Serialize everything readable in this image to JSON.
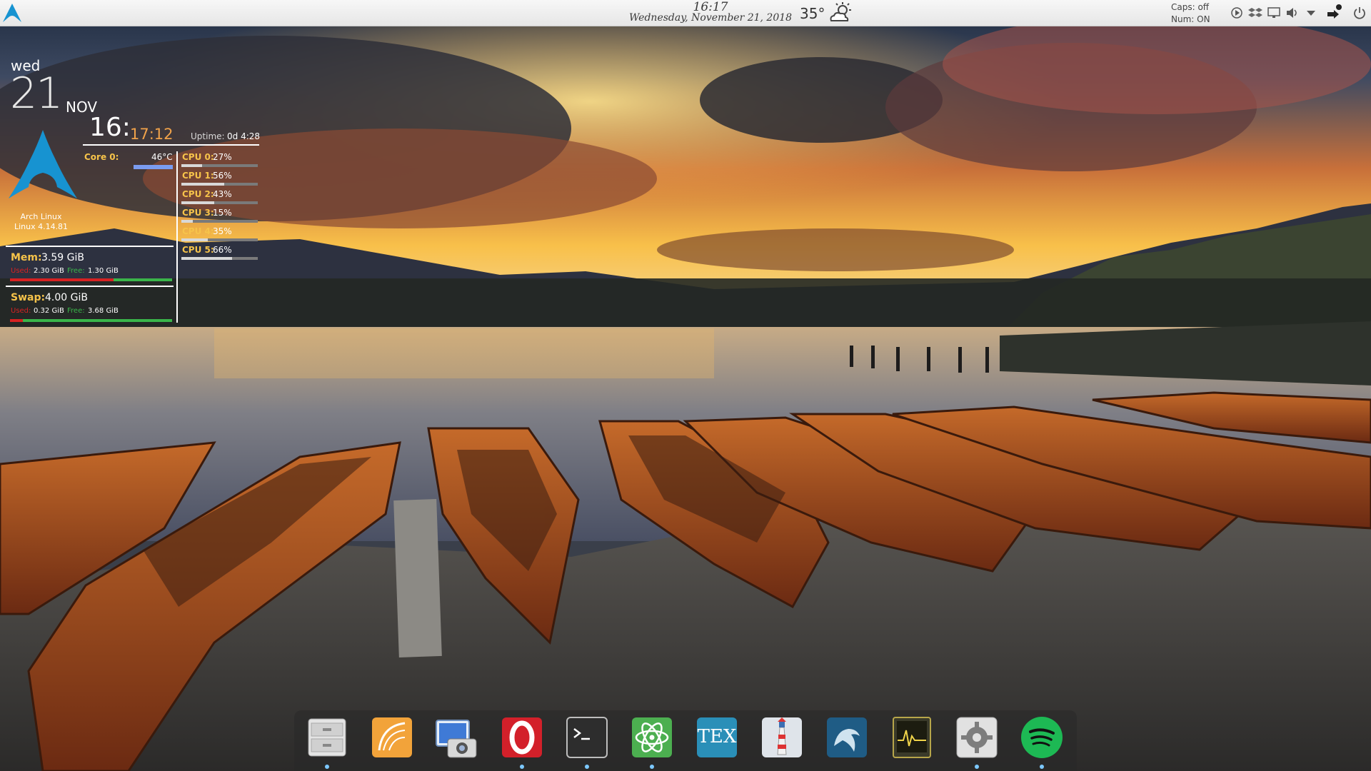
{
  "panel": {
    "time": "16:17",
    "date": "Wednesday, November 21, 2018",
    "weather_temp": "35°",
    "weather_icon": "partly-sunny-icon",
    "caps": "Caps: off",
    "num": "Num: ON",
    "tray_icons": [
      "media-play-icon",
      "dropbox-icon",
      "display-icon",
      "volume-icon",
      "chevron-down-icon",
      "network-icon",
      "power-icon"
    ]
  },
  "conky": {
    "day": "wed",
    "date": "21",
    "month": "NOV",
    "hour_min": "16:",
    "seconds": "17:12",
    "uptime_label": "Uptime:",
    "uptime_value": "0d 4:28",
    "distro": "Arch Linux",
    "kernel": "Linux 4.14.81",
    "core_label": "Core 0:",
    "core_temp": "46°C",
    "cpus": [
      {
        "label": "CPU 0:",
        "value": "27%",
        "pct": 27
      },
      {
        "label": "CPU 1:",
        "value": "56%",
        "pct": 56
      },
      {
        "label": "CPU 2:",
        "value": "43%",
        "pct": 43
      },
      {
        "label": "CPU 3:",
        "value": "15%",
        "pct": 15
      },
      {
        "label": "CPU 4:",
        "value": "35%",
        "pct": 35
      },
      {
        "label": "CPU 5:",
        "value": "66%",
        "pct": 66
      }
    ],
    "mem_label": "Mem:",
    "mem_total": "3.59 GiB",
    "mem_used_label": "Used:",
    "mem_used": "2.30 GiB",
    "mem_free_label": "Free:",
    "mem_free": "1.30 GiB",
    "mem_used_frac": 0.64,
    "swap_label": "Swap:",
    "swap_total": "4.00 GiB",
    "swap_used_label": "Used:",
    "swap_used": "0.32 GiB",
    "swap_free_label": "Free:",
    "swap_free": "3.68 GiB",
    "swap_used_frac": 0.08
  },
  "dock": {
    "items": [
      {
        "name": "file-manager-icon",
        "active": true
      },
      {
        "name": "sublime-text-icon",
        "active": false
      },
      {
        "name": "screenshot-icon",
        "active": false
      },
      {
        "name": "opera-icon",
        "active": true
      },
      {
        "name": "terminal-icon",
        "active": true
      },
      {
        "name": "atom-icon",
        "active": true
      },
      {
        "name": "tex-icon",
        "active": false
      },
      {
        "name": "lighthouse-icon",
        "active": false
      },
      {
        "name": "mysql-workbench-icon",
        "active": false
      },
      {
        "name": "system-monitor-icon",
        "active": false
      },
      {
        "name": "settings-icon",
        "active": true
      },
      {
        "name": "spotify-icon",
        "active": true
      }
    ],
    "tex_label": "TEX"
  },
  "colors": {
    "accent_yellow": "#f6c34a",
    "arch_blue": "#1793d1",
    "bar_red": "#d62222",
    "bar_green": "#3ab54a",
    "dock_indicator": "#7cc8ff"
  }
}
